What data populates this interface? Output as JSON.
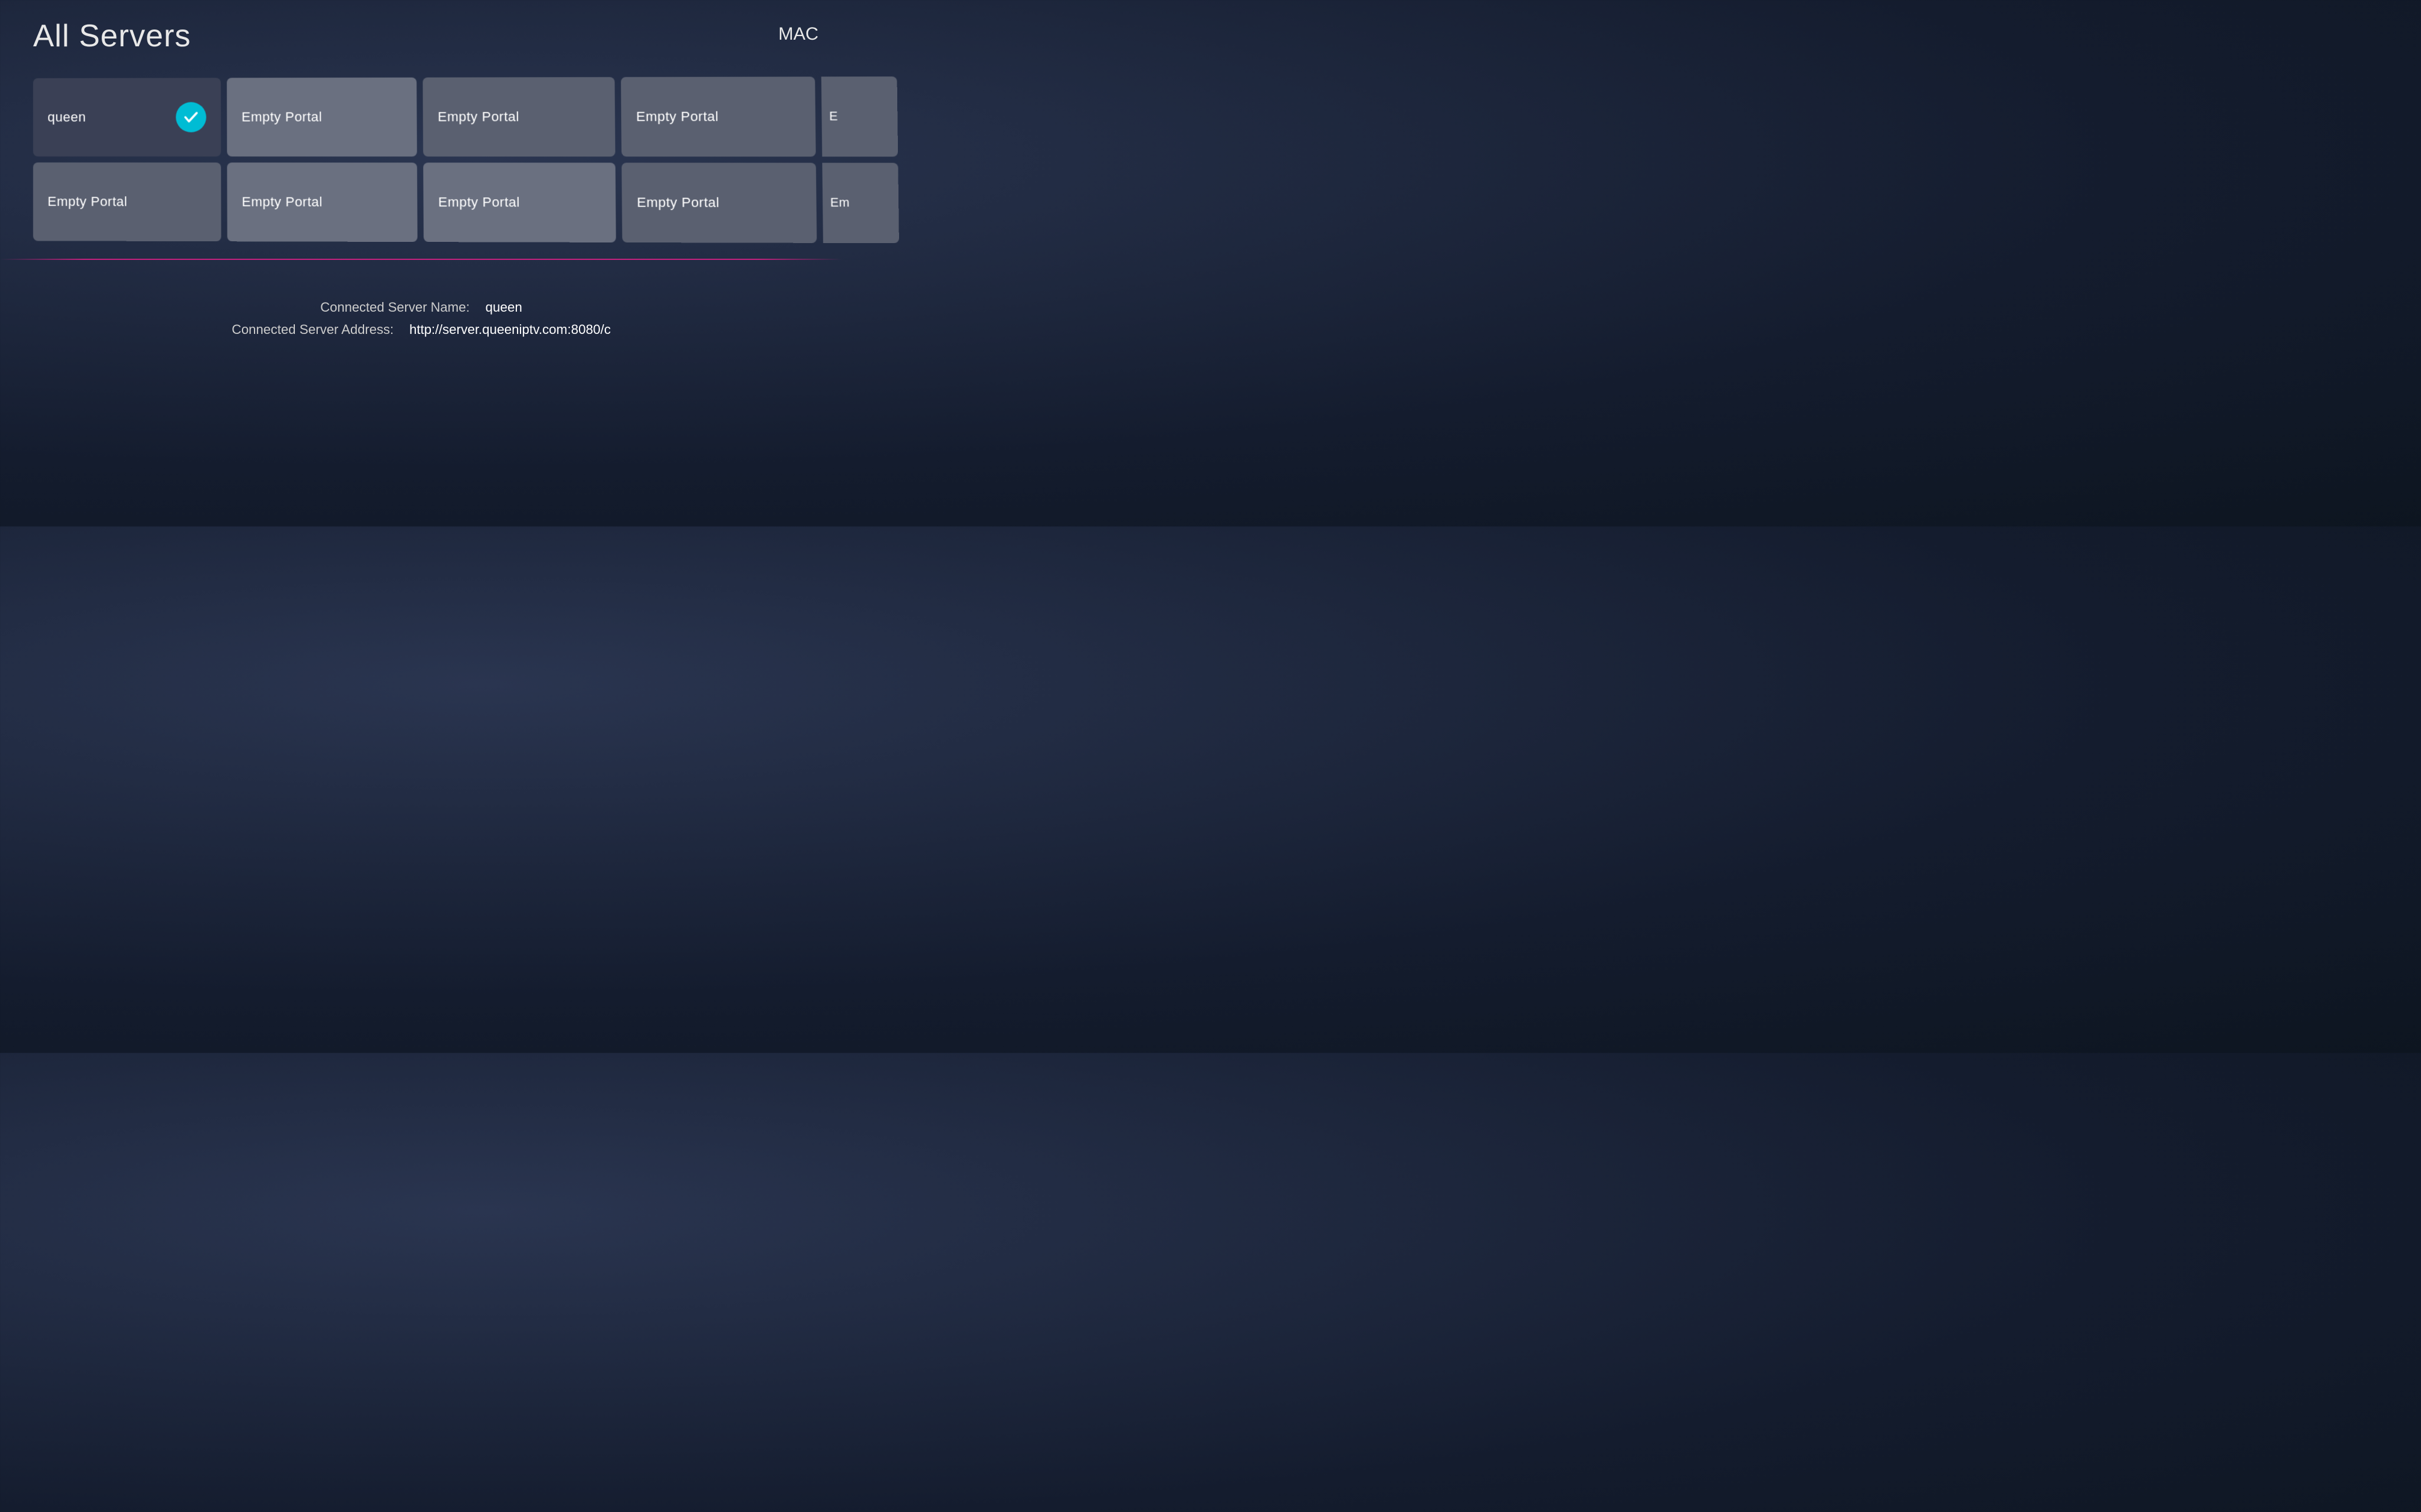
{
  "header": {
    "title": "All Servers",
    "mac_label": "MAC"
  },
  "grid": {
    "tiles": [
      {
        "id": "queen",
        "label": "queen",
        "selected": true,
        "row": 1,
        "col": 1
      },
      {
        "id": "empty1",
        "label": "Empty Portal",
        "selected": false,
        "row": 1,
        "col": 2
      },
      {
        "id": "empty2",
        "label": "Empty Portal",
        "selected": false,
        "row": 1,
        "col": 3
      },
      {
        "id": "empty3",
        "label": "Empty Portal",
        "selected": false,
        "row": 1,
        "col": 4
      },
      {
        "id": "empty4-partial",
        "label": "E",
        "selected": false,
        "row": 1,
        "col": 5,
        "partial": true
      },
      {
        "id": "empty5",
        "label": "Empty Portal",
        "selected": false,
        "row": 2,
        "col": 1
      },
      {
        "id": "empty6",
        "label": "Empty Portal",
        "selected": false,
        "row": 2,
        "col": 2
      },
      {
        "id": "empty7",
        "label": "Empty Portal",
        "selected": false,
        "row": 2,
        "col": 3
      },
      {
        "id": "empty8",
        "label": "Empty Portal",
        "selected": false,
        "row": 2,
        "col": 4
      },
      {
        "id": "empty9-partial",
        "label": "Em",
        "selected": false,
        "row": 2,
        "col": 5,
        "partial": true
      }
    ]
  },
  "bottom_info": {
    "server_name_label": "Connected Server Name:",
    "server_name_value": "queen",
    "server_address_label": "Connected Server Address:",
    "server_address_value": "http://server.queeniptv.com:8080/c"
  }
}
